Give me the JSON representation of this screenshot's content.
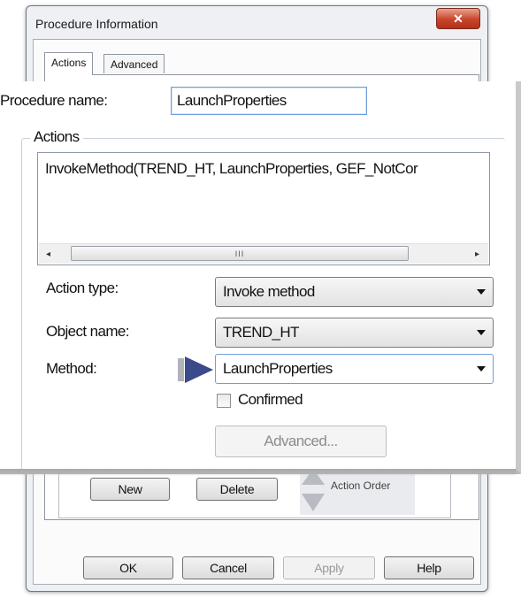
{
  "dialog": {
    "title": "Procedure Information",
    "close_glyph": "✕",
    "tabs": [
      "Actions",
      "Advanced"
    ],
    "buttons": {
      "new": "New",
      "delete": "Delete",
      "action_order": "Action Order"
    },
    "footer": {
      "ok": "OK",
      "cancel": "Cancel",
      "apply": "Apply",
      "help": "Help"
    }
  },
  "overlay": {
    "procedure_name_label": "Procedure name:",
    "procedure_name_value": "LaunchProperties",
    "actions_legend": "Actions",
    "action_items": [
      "InvokeMethod(TREND_HT, LaunchProperties, GEF_NotCor"
    ],
    "scrollbar": {
      "left": "◂",
      "thumb": "III",
      "right": "▸"
    },
    "action_type_label": "Action type:",
    "action_type_value": "Invoke method",
    "object_name_label": "Object name:",
    "object_name_value": "TREND_HT",
    "method_label": "Method:",
    "method_value": "LaunchProperties",
    "confirmed_label": "Confirmed",
    "advanced_button": "Advanced..."
  },
  "colors": {
    "pointer_arrow": "#3a4a8a",
    "close_button": "#c9432a",
    "input_focus_border": "#6f9fd8"
  }
}
